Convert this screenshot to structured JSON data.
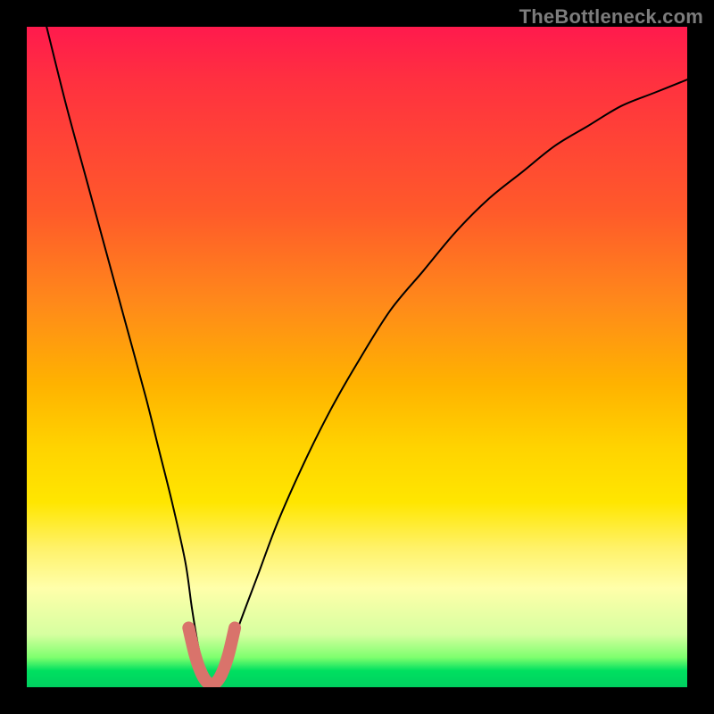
{
  "watermark": "TheBottleneck.com",
  "chart_data": {
    "type": "line",
    "title": "",
    "xlabel": "",
    "ylabel": "",
    "xlim": [
      0,
      100
    ],
    "ylim": [
      0,
      100
    ],
    "grid": false,
    "legend": false,
    "annotations": [],
    "series": [
      {
        "name": "bottleneck-curve",
        "color": "#000000",
        "stroke_width": 2,
        "x": [
          0,
          3,
          6,
          9,
          12,
          15,
          18,
          20,
          22,
          24,
          25,
          26,
          27,
          28,
          29,
          30,
          32,
          35,
          38,
          42,
          46,
          50,
          55,
          60,
          65,
          70,
          75,
          80,
          85,
          90,
          95,
          100
        ],
        "values": [
          112,
          100,
          88,
          77,
          66,
          55,
          44,
          36,
          28,
          19,
          12,
          6,
          2,
          0,
          1,
          3,
          9,
          17,
          25,
          34,
          42,
          49,
          57,
          63,
          69,
          74,
          78,
          82,
          85,
          88,
          90,
          92
        ]
      },
      {
        "name": "optimal-highlight",
        "color": "#d9736b",
        "stroke_width": 14,
        "x": [
          24.5,
          25.5,
          26.5,
          27.5,
          28.5,
          29.5,
          30.5,
          31.5
        ],
        "values": [
          9.0,
          4.8,
          2.0,
          0.6,
          0.6,
          2.0,
          4.8,
          9.0
        ]
      }
    ]
  }
}
